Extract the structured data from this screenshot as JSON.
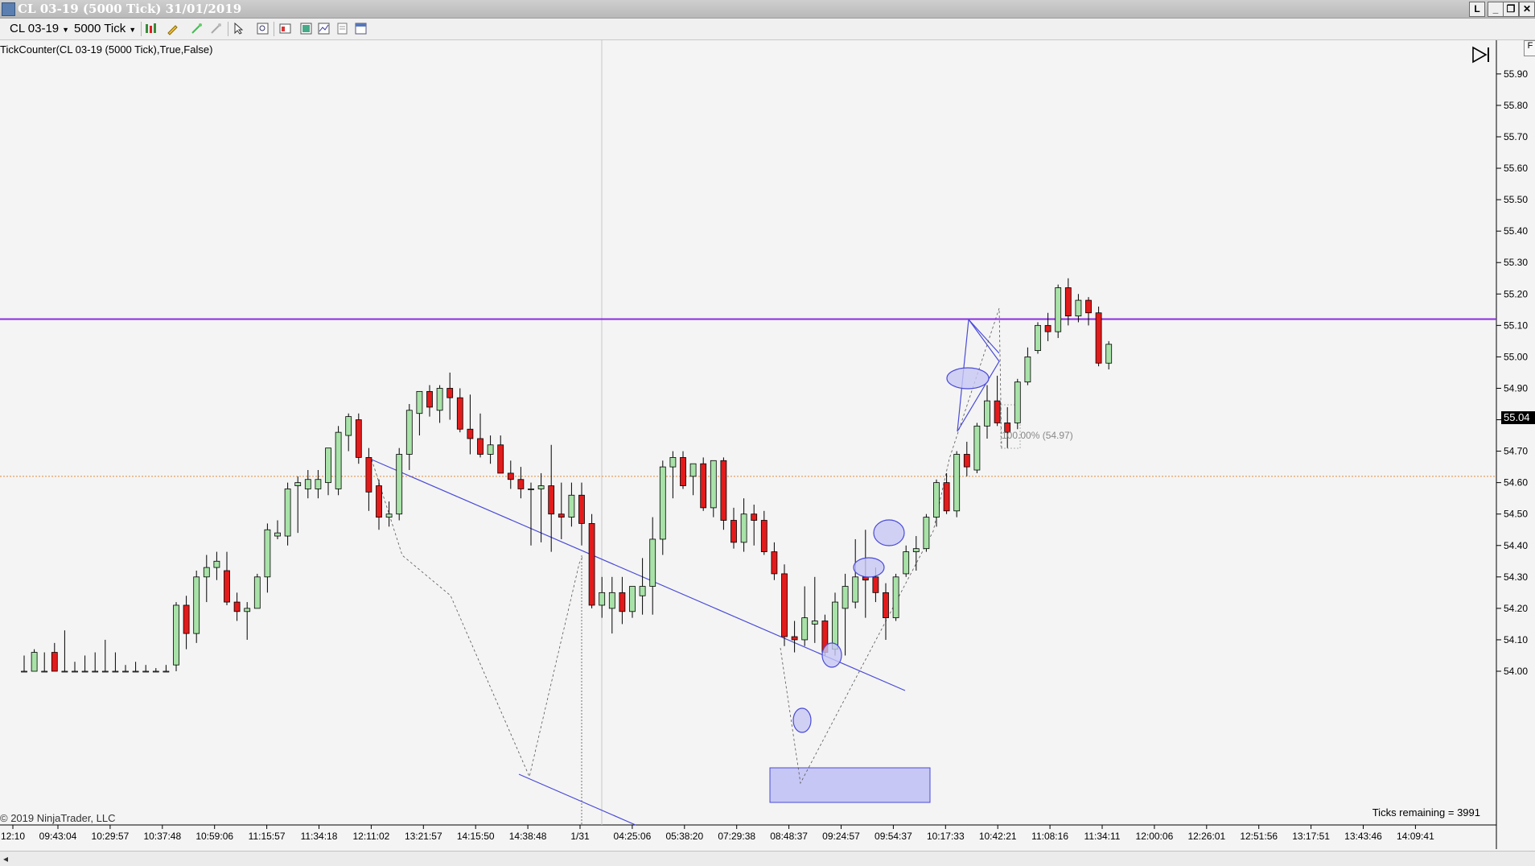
{
  "window": {
    "title": "CL 03-19 (5000 Tick)  31/01/2019",
    "buttons": [
      "L",
      "_",
      "❐",
      "✕"
    ]
  },
  "toolbar": {
    "instrument": "CL 03-19",
    "interval": "5000 Tick",
    "icons": [
      "bar-chart-icon",
      "pencil-icon",
      "magic-wand-icon",
      "eraser-icon",
      "pointer-icon",
      "zoom-icon",
      "data-box-icon",
      "strategy-icon",
      "chart-style-icon",
      "properties-icon",
      "template-icon"
    ]
  },
  "chart": {
    "indicator_label": "TickCounter(CL  03-19  (5000  Tick),True,False)",
    "ticks_remaining": "Ticks remaining = 3991",
    "copyright": "© 2019 NinjaTrader, LLC",
    "last_price": "55.04",
    "fib_label": "100.00% (54.97)",
    "colors": {
      "up": "#a8e2a8",
      "down": "#e31b1b",
      "hline_purple": "#8a2be2",
      "hline_orange": "#e08a3c",
      "drawing": "#4a4ad8",
      "fill": "#c7c7f5"
    },
    "price_ticks": [
      "55.90",
      "55.80",
      "55.70",
      "55.60",
      "55.50",
      "55.40",
      "55.30",
      "55.20",
      "55.10",
      "55.00",
      "54.90",
      "54.80",
      "54.70",
      "54.60",
      "54.50",
      "54.40",
      "54.30",
      "54.20",
      "54.10",
      "54.00"
    ],
    "time_ticks": [
      "12:10",
      "09:43:04",
      "10:29:57",
      "10:37:48",
      "10:59:06",
      "11:15:57",
      "11:34:18",
      "12:11:02",
      "13:21:57",
      "14:15:50",
      "14:38:48",
      "1/31",
      "04:25:06",
      "05:38:20",
      "07:29:38",
      "08:48:37",
      "09:24:57",
      "09:54:37",
      "10:17:33",
      "10:42:21",
      "11:08:16",
      "11:34:11",
      "12:00:06",
      "12:26:01",
      "12:51:56",
      "13:17:51",
      "13:43:46",
      "14:09:41"
    ]
  },
  "chart_data": {
    "type": "candlestick",
    "ylim": [
      54.0,
      55.97
    ],
    "hlines": [
      55.12,
      54.62
    ],
    "candles": [
      {
        "o": 54.0,
        "h": 54.05,
        "l": 54.0,
        "c": 54.0
      },
      {
        "o": 54.0,
        "h": 54.07,
        "l": 54.0,
        "c": 54.06
      },
      {
        "o": 54.0,
        "h": 54.06,
        "l": 54.0,
        "c": 54.0
      },
      {
        "o": 54.06,
        "h": 54.09,
        "l": 54.0,
        "c": 54.0
      },
      {
        "o": 54.0,
        "h": 54.13,
        "l": 54.0,
        "c": 54.0
      },
      {
        "o": 54.0,
        "h": 54.03,
        "l": 54.0,
        "c": 54.0
      },
      {
        "o": 54.0,
        "h": 54.05,
        "l": 54.0,
        "c": 54.0
      },
      {
        "o": 54.0,
        "h": 54.06,
        "l": 54.0,
        "c": 54.0
      },
      {
        "o": 54.0,
        "h": 54.1,
        "l": 54.0,
        "c": 54.0
      },
      {
        "o": 54.0,
        "h": 54.06,
        "l": 54.0,
        "c": 54.0
      },
      {
        "o": 54.0,
        "h": 54.02,
        "l": 54.0,
        "c": 54.0
      },
      {
        "o": 54.0,
        "h": 54.03,
        "l": 54.0,
        "c": 54.0
      },
      {
        "o": 54.0,
        "h": 54.02,
        "l": 54.0,
        "c": 54.0
      },
      {
        "o": 54.0,
        "h": 54.01,
        "l": 54.0,
        "c": 54.0
      },
      {
        "o": 54.0,
        "h": 54.02,
        "l": 54.0,
        "c": 54.0
      },
      {
        "o": 54.02,
        "h": 54.22,
        "l": 54.0,
        "c": 54.21
      },
      {
        "o": 54.21,
        "h": 54.24,
        "l": 54.07,
        "c": 54.12
      },
      {
        "o": 54.12,
        "h": 54.32,
        "l": 54.09,
        "c": 54.3
      },
      {
        "o": 54.3,
        "h": 54.37,
        "l": 54.22,
        "c": 54.33
      },
      {
        "o": 54.33,
        "h": 54.38,
        "l": 54.29,
        "c": 54.35
      },
      {
        "o": 54.32,
        "h": 54.38,
        "l": 54.21,
        "c": 54.22
      },
      {
        "o": 54.22,
        "h": 54.25,
        "l": 54.16,
        "c": 54.19
      },
      {
        "o": 54.19,
        "h": 54.22,
        "l": 54.1,
        "c": 54.2
      },
      {
        "o": 54.2,
        "h": 54.31,
        "l": 54.2,
        "c": 54.3
      },
      {
        "o": 54.3,
        "h": 54.47,
        "l": 54.25,
        "c": 54.45
      },
      {
        "o": 54.43,
        "h": 54.48,
        "l": 54.42,
        "c": 54.44
      },
      {
        "o": 54.43,
        "h": 54.6,
        "l": 54.4,
        "c": 54.58
      },
      {
        "o": 54.59,
        "h": 54.62,
        "l": 54.44,
        "c": 54.6
      },
      {
        "o": 54.58,
        "h": 54.64,
        "l": 54.55,
        "c": 54.61
      },
      {
        "o": 54.58,
        "h": 54.64,
        "l": 54.55,
        "c": 54.61
      },
      {
        "o": 54.6,
        "h": 54.71,
        "l": 54.56,
        "c": 54.71
      },
      {
        "o": 54.58,
        "h": 54.78,
        "l": 54.56,
        "c": 54.76
      },
      {
        "o": 54.75,
        "h": 54.82,
        "l": 54.7,
        "c": 54.81
      },
      {
        "o": 54.8,
        "h": 54.82,
        "l": 54.66,
        "c": 54.68
      },
      {
        "o": 54.68,
        "h": 54.71,
        "l": 54.51,
        "c": 54.57
      },
      {
        "o": 54.59,
        "h": 54.61,
        "l": 54.45,
        "c": 54.49
      },
      {
        "o": 54.49,
        "h": 54.54,
        "l": 54.46,
        "c": 54.5
      },
      {
        "o": 54.5,
        "h": 54.71,
        "l": 54.48,
        "c": 54.69
      },
      {
        "o": 54.69,
        "h": 54.85,
        "l": 54.64,
        "c": 54.83
      },
      {
        "o": 54.82,
        "h": 54.89,
        "l": 54.75,
        "c": 54.89
      },
      {
        "o": 54.89,
        "h": 54.91,
        "l": 54.81,
        "c": 54.84
      },
      {
        "o": 54.83,
        "h": 54.91,
        "l": 54.79,
        "c": 54.9
      },
      {
        "o": 54.9,
        "h": 54.95,
        "l": 54.8,
        "c": 54.87
      },
      {
        "o": 54.87,
        "h": 54.9,
        "l": 54.76,
        "c": 54.77
      },
      {
        "o": 54.77,
        "h": 54.88,
        "l": 54.69,
        "c": 54.74
      },
      {
        "o": 54.74,
        "h": 54.82,
        "l": 54.68,
        "c": 54.69
      },
      {
        "o": 54.69,
        "h": 54.75,
        "l": 54.66,
        "c": 54.72
      },
      {
        "o": 54.72,
        "h": 54.75,
        "l": 54.65,
        "c": 54.63
      },
      {
        "o": 54.63,
        "h": 54.67,
        "l": 54.58,
        "c": 54.61
      },
      {
        "o": 54.61,
        "h": 54.65,
        "l": 54.55,
        "c": 54.58
      },
      {
        "o": 54.58,
        "h": 54.6,
        "l": 54.4,
        "c": 54.58
      },
      {
        "o": 54.58,
        "h": 54.63,
        "l": 54.41,
        "c": 54.59
      },
      {
        "o": 54.59,
        "h": 54.72,
        "l": 54.38,
        "c": 54.5
      },
      {
        "o": 54.5,
        "h": 54.6,
        "l": 54.42,
        "c": 54.49
      },
      {
        "o": 54.49,
        "h": 54.6,
        "l": 54.46,
        "c": 54.56
      },
      {
        "o": 54.56,
        "h": 54.6,
        "l": 54.4,
        "c": 54.47
      },
      {
        "o": 54.47,
        "h": 54.5,
        "l": 54.2,
        "c": 54.21
      },
      {
        "o": 54.21,
        "h": 54.3,
        "l": 54.17,
        "c": 54.25
      },
      {
        "o": 54.2,
        "h": 54.3,
        "l": 54.12,
        "c": 54.25
      },
      {
        "o": 54.25,
        "h": 54.3,
        "l": 54.15,
        "c": 54.19
      },
      {
        "o": 54.19,
        "h": 54.27,
        "l": 54.17,
        "c": 54.27
      },
      {
        "o": 54.24,
        "h": 54.36,
        "l": 54.18,
        "c": 54.27
      },
      {
        "o": 54.27,
        "h": 54.49,
        "l": 54.18,
        "c": 54.42
      },
      {
        "o": 54.42,
        "h": 54.67,
        "l": 54.37,
        "c": 54.65
      },
      {
        "o": 54.65,
        "h": 54.7,
        "l": 54.55,
        "c": 54.68
      },
      {
        "o": 54.68,
        "h": 54.7,
        "l": 54.58,
        "c": 54.59
      },
      {
        "o": 54.62,
        "h": 54.65,
        "l": 54.56,
        "c": 54.66
      },
      {
        "o": 54.66,
        "h": 54.68,
        "l": 54.51,
        "c": 54.52
      },
      {
        "o": 54.52,
        "h": 54.55,
        "l": 54.49,
        "c": 54.67
      },
      {
        "o": 54.67,
        "h": 54.68,
        "l": 54.45,
        "c": 54.48
      },
      {
        "o": 54.48,
        "h": 54.52,
        "l": 54.39,
        "c": 54.41
      },
      {
        "o": 54.41,
        "h": 54.55,
        "l": 54.38,
        "c": 54.5
      },
      {
        "o": 54.5,
        "h": 54.53,
        "l": 54.4,
        "c": 54.48
      },
      {
        "o": 54.48,
        "h": 54.51,
        "l": 54.37,
        "c": 54.38
      },
      {
        "o": 54.38,
        "h": 54.41,
        "l": 54.29,
        "c": 54.31
      },
      {
        "o": 54.31,
        "h": 54.34,
        "l": 54.08,
        "c": 54.11
      },
      {
        "o": 54.11,
        "h": 54.16,
        "l": 54.06,
        "c": 54.1
      },
      {
        "o": 54.1,
        "h": 54.27,
        "l": 54.08,
        "c": 54.17
      },
      {
        "o": 54.15,
        "h": 54.3,
        "l": 54.09,
        "c": 54.16
      },
      {
        "o": 54.16,
        "h": 54.18,
        "l": 54.05,
        "c": 54.06
      },
      {
        "o": 54.07,
        "h": 54.25,
        "l": 54.05,
        "c": 54.22
      },
      {
        "o": 54.2,
        "h": 54.31,
        "l": 54.05,
        "c": 54.27
      },
      {
        "o": 54.22,
        "h": 54.42,
        "l": 54.2,
        "c": 54.3
      },
      {
        "o": 54.3,
        "h": 54.45,
        "l": 54.17,
        "c": 54.29
      },
      {
        "o": 54.3,
        "h": 54.33,
        "l": 54.22,
        "c": 54.25
      },
      {
        "o": 54.25,
        "h": 54.28,
        "l": 54.1,
        "c": 54.17
      },
      {
        "o": 54.17,
        "h": 54.31,
        "l": 54.16,
        "c": 54.3
      },
      {
        "o": 54.31,
        "h": 54.4,
        "l": 54.3,
        "c": 54.38
      },
      {
        "o": 54.38,
        "h": 54.43,
        "l": 54.32,
        "c": 54.39
      },
      {
        "o": 54.39,
        "h": 54.5,
        "l": 54.38,
        "c": 54.49
      },
      {
        "o": 54.49,
        "h": 54.61,
        "l": 54.46,
        "c": 54.6
      },
      {
        "o": 54.6,
        "h": 54.63,
        "l": 54.5,
        "c": 54.51
      },
      {
        "o": 54.51,
        "h": 54.7,
        "l": 54.49,
        "c": 54.69
      },
      {
        "o": 54.69,
        "h": 54.73,
        "l": 54.62,
        "c": 54.65
      },
      {
        "o": 54.64,
        "h": 54.79,
        "l": 54.63,
        "c": 54.78
      },
      {
        "o": 54.78,
        "h": 54.91,
        "l": 54.74,
        "c": 54.86
      },
      {
        "o": 54.86,
        "h": 54.94,
        "l": 54.78,
        "c": 54.79
      },
      {
        "o": 54.79,
        "h": 54.84,
        "l": 54.71,
        "c": 54.76
      },
      {
        "o": 54.79,
        "h": 54.93,
        "l": 54.77,
        "c": 54.92
      },
      {
        "o": 54.92,
        "h": 55.03,
        "l": 54.91,
        "c": 55.0
      },
      {
        "o": 55.02,
        "h": 55.11,
        "l": 55.01,
        "c": 55.1
      },
      {
        "o": 55.1,
        "h": 55.14,
        "l": 55.05,
        "c": 55.08
      },
      {
        "o": 55.08,
        "h": 55.23,
        "l": 55.06,
        "c": 55.22
      },
      {
        "o": 55.22,
        "h": 55.25,
        "l": 55.1,
        "c": 55.13
      },
      {
        "o": 55.13,
        "h": 55.2,
        "l": 55.11,
        "c": 55.18
      },
      {
        "o": 55.18,
        "h": 55.19,
        "l": 55.1,
        "c": 55.14
      },
      {
        "o": 55.14,
        "h": 55.16,
        "l": 54.97,
        "c": 54.98
      },
      {
        "o": 54.98,
        "h": 55.05,
        "l": 54.96,
        "c": 55.04
      }
    ]
  }
}
